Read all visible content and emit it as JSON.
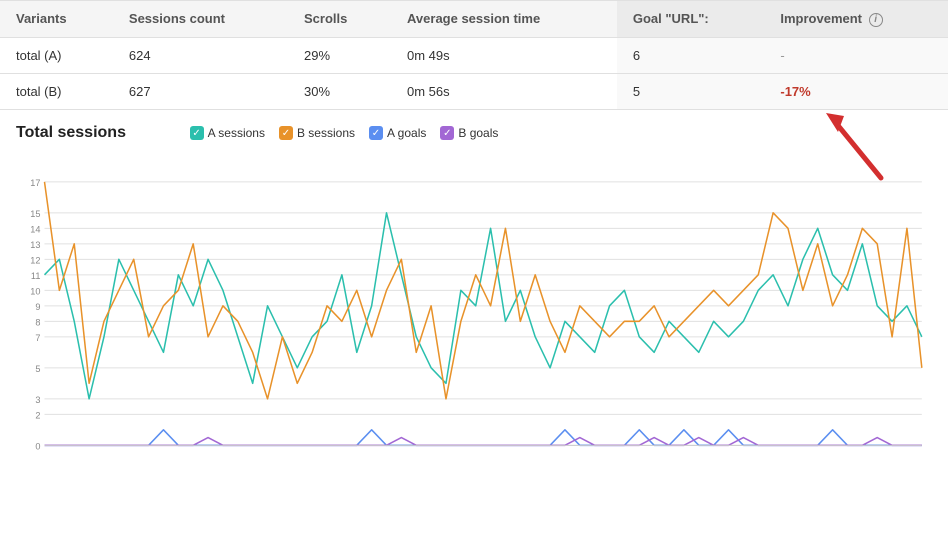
{
  "table": {
    "headers": [
      "Variants",
      "Sessions count",
      "Scrolls",
      "Average session time",
      "Goal \"URL\":",
      "Improvement"
    ],
    "rows": [
      {
        "variant": "total (A)",
        "sessions": "624",
        "scrolls": "29%",
        "avg_session": "0m 49s",
        "goal": "6",
        "improvement": "-",
        "improvement_type": "neutral"
      },
      {
        "variant": "total (B)",
        "sessions": "627",
        "scrolls": "30%",
        "avg_session": "0m 56s",
        "goal": "5",
        "improvement": "-17%",
        "improvement_type": "negative"
      }
    ]
  },
  "chart": {
    "title": "Total sessions",
    "legend": [
      {
        "label": "A sessions",
        "color": "#2bbfad",
        "shape": "check"
      },
      {
        "label": "B sessions",
        "color": "#e8922a",
        "shape": "check"
      },
      {
        "label": "A goals",
        "color": "#5b8ef0",
        "shape": "check"
      },
      {
        "label": "B goals",
        "color": "#a267d4",
        "shape": "check"
      }
    ],
    "y_labels": [
      "0",
      "2",
      "3",
      "5",
      "7",
      "8",
      "9",
      "10",
      "11",
      "12",
      "13",
      "14",
      "15",
      "17"
    ],
    "y_ticks": [
      0,
      2,
      3,
      5,
      7,
      8,
      9,
      10,
      11,
      12,
      13,
      14,
      15,
      17
    ]
  },
  "improvement_info_tooltip": "Improvement information"
}
